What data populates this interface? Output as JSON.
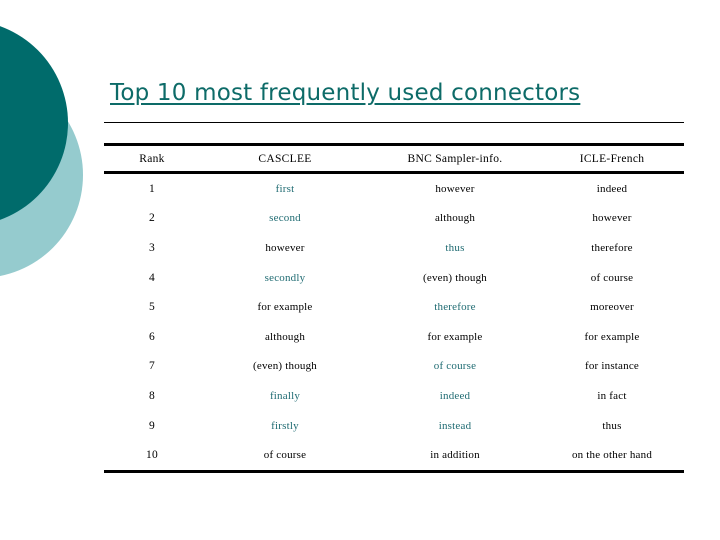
{
  "slide": {
    "title": "Top 10 most frequently used connectors",
    "accent_color": "#0d6b68",
    "highlight_color": "#1f6b72",
    "deco_dark_color": "#006b6b",
    "deco_light_color": "#95cbce"
  },
  "table": {
    "headers": [
      "Rank",
      "CASCLEE",
      "BNC Sampler-info.",
      "ICLE-French"
    ],
    "rows": [
      {
        "rank": "1",
        "casclee": "first",
        "casclee_hl": true,
        "bnc": "however",
        "bnc_hl": false,
        "icle": "indeed",
        "icle_hl": false
      },
      {
        "rank": "2",
        "casclee": "second",
        "casclee_hl": true,
        "bnc": "although",
        "bnc_hl": false,
        "icle": "however",
        "icle_hl": false
      },
      {
        "rank": "3",
        "casclee": "however",
        "casclee_hl": false,
        "bnc": "thus",
        "bnc_hl": true,
        "icle": "therefore",
        "icle_hl": false
      },
      {
        "rank": "4",
        "casclee": "secondly",
        "casclee_hl": true,
        "bnc": "(even) though",
        "bnc_hl": false,
        "icle": "of course",
        "icle_hl": false
      },
      {
        "rank": "5",
        "casclee": "for example",
        "casclee_hl": false,
        "bnc": "therefore",
        "bnc_hl": true,
        "icle": "moreover",
        "icle_hl": false
      },
      {
        "rank": "6",
        "casclee": "although",
        "casclee_hl": false,
        "bnc": "for example",
        "bnc_hl": false,
        "icle": "for example",
        "icle_hl": false
      },
      {
        "rank": "7",
        "casclee": "(even) though",
        "casclee_hl": false,
        "bnc": "of course",
        "bnc_hl": true,
        "icle": "for instance",
        "icle_hl": false
      },
      {
        "rank": "8",
        "casclee": "finally",
        "casclee_hl": true,
        "bnc": "indeed",
        "bnc_hl": true,
        "icle": "in fact",
        "icle_hl": false
      },
      {
        "rank": "9",
        "casclee": "firstly",
        "casclee_hl": true,
        "bnc": "instead",
        "bnc_hl": true,
        "icle": "thus",
        "icle_hl": false
      },
      {
        "rank": "10",
        "casclee": "of course",
        "casclee_hl": false,
        "bnc": "in addition",
        "bnc_hl": false,
        "icle": "on the other hand",
        "icle_hl": false
      }
    ]
  }
}
